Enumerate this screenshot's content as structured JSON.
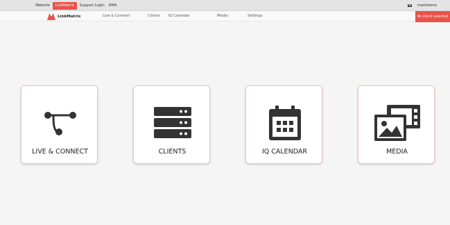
{
  "topbar": {
    "links": [
      "Website",
      "LinkMatrix",
      "Support Login",
      "RMA"
    ],
    "active_link": "LinkMatrix",
    "username": "markdemo"
  },
  "nav": {
    "brand": "LinkMatrix",
    "items": [
      "Live & Connect",
      "Clients",
      "IQ Calendar",
      "Media",
      "Settings"
    ],
    "client_badge": "No client selected"
  },
  "cards": [
    {
      "label": "LIVE & CONNECT",
      "icon": "route-icon"
    },
    {
      "label": "CLIENTS",
      "icon": "server-stack-icon"
    },
    {
      "label": "IQ CALENDAR",
      "icon": "calendar-icon"
    },
    {
      "label": "MEDIA",
      "icon": "images-icon"
    }
  ],
  "colors": {
    "accent": "#e8534a",
    "icon": "#333333"
  }
}
